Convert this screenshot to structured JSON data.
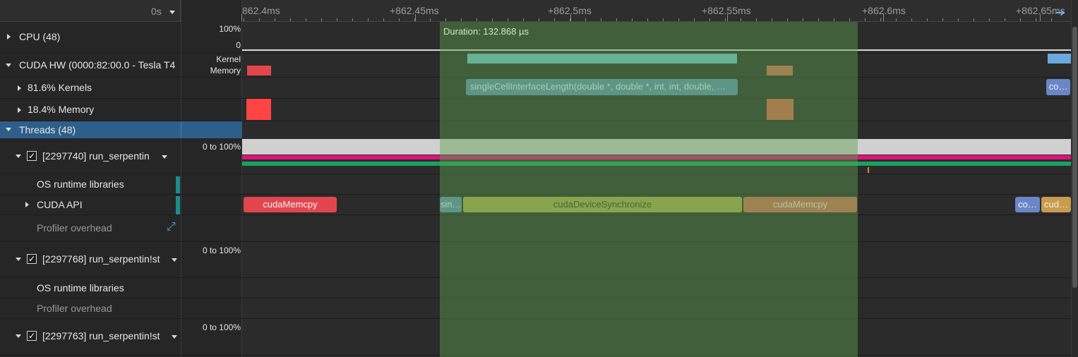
{
  "ruler": {
    "origin": "0s",
    "ticks": [
      "862.4ms",
      "+862.45ms",
      "+862.5ms",
      "+862.55ms",
      "+862.6ms",
      "+862.65ms"
    ]
  },
  "selection": {
    "label": "Duration: 132.868 µs"
  },
  "cpu": {
    "label": "CPU (48)",
    "scale_top": "100%",
    "scale_bottom": "0"
  },
  "cuda_hw": {
    "label": "CUDA HW (0000:82:00.0 - Tesla T4",
    "kernel_label": "Kernel",
    "memory_label": "Memory"
  },
  "kernels": {
    "label": "81.6% Kernels",
    "bar1": "singleCellInterfaceLength(double *, double *, int, int, double, …",
    "bar2": "co…"
  },
  "memory": {
    "label": "18.4% Memory"
  },
  "threads": {
    "label": "Threads (48)"
  },
  "thread1": {
    "label": "[2297740] run_serpentin",
    "scale": "0 to 100%",
    "os_runtime": "OS runtime libraries",
    "cuda_api": "CUDA API",
    "profiler_overhead": "Profiler overhead",
    "api_calls": {
      "memcpy1": "cudaMemcpy",
      "sin": "sin…",
      "sync": "cudaDeviceSynchronize",
      "memcpy2": "cudaMemcpy",
      "co": "co…",
      "cud": "cud…"
    }
  },
  "thread2": {
    "label": "[2297768] run_serpentin!st",
    "scale": "0 to 100%",
    "os_runtime": "OS runtime libraries",
    "profiler_overhead": "Profiler overhead"
  },
  "thread3": {
    "label": "[2297763] run_serpentin!st",
    "scale": "0 to 100%"
  },
  "colors": {
    "selection": "#4e7a40",
    "threads_header": "#2d5f8a",
    "kernel_bar": "#6fc0cc",
    "memcpy_red": "#e2464d",
    "memcpy_orange": "#d26a52",
    "sync_yellow": "#a9a94e",
    "api_blue": "#5b8fb3",
    "util_magenta": "#e0127a",
    "util_green": "#1aa060"
  }
}
